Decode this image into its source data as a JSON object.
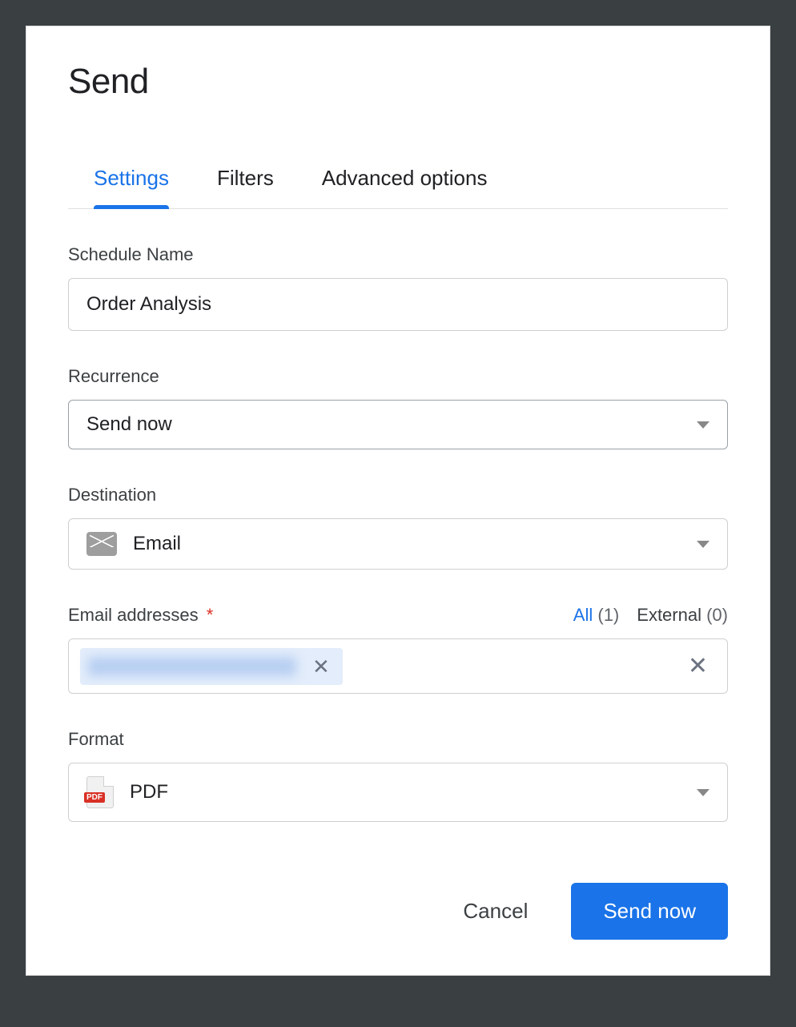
{
  "dialog": {
    "title": "Send"
  },
  "tabs": {
    "settings": "Settings",
    "filters": "Filters",
    "advanced": "Advanced options"
  },
  "fields": {
    "schedule_name": {
      "label": "Schedule Name",
      "value": "Order Analysis"
    },
    "recurrence": {
      "label": "Recurrence",
      "value": "Send now"
    },
    "destination": {
      "label": "Destination",
      "value": "Email",
      "icon": "email-icon"
    },
    "email_addresses": {
      "label": "Email addresses",
      "required_mark": "*",
      "count_tabs": {
        "all_label": "All",
        "all_count": "(1)",
        "external_label": "External",
        "external_count": "(0)"
      },
      "chips": [
        {
          "text_redacted": true
        }
      ]
    },
    "format": {
      "label": "Format",
      "value": "PDF",
      "icon": "pdf-icon"
    }
  },
  "footer": {
    "cancel": "Cancel",
    "send_now": "Send now"
  }
}
